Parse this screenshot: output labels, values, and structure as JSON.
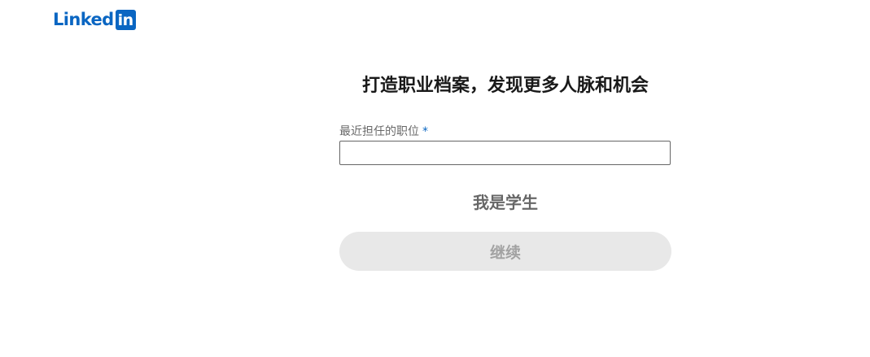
{
  "header": {
    "logo_text": "Linked",
    "logo_box_text": "in"
  },
  "main": {
    "title": "打造职业档案，发现更多人脉和机会",
    "job_title_field": {
      "label": "最近担任的职位",
      "required_marker": "*",
      "value": "",
      "placeholder": ""
    },
    "student_button_label": "我是学生",
    "continue_button_label": "继续"
  },
  "colors": {
    "brand": "#0a66c2",
    "disabled_button_bg": "#e8e8e8"
  }
}
